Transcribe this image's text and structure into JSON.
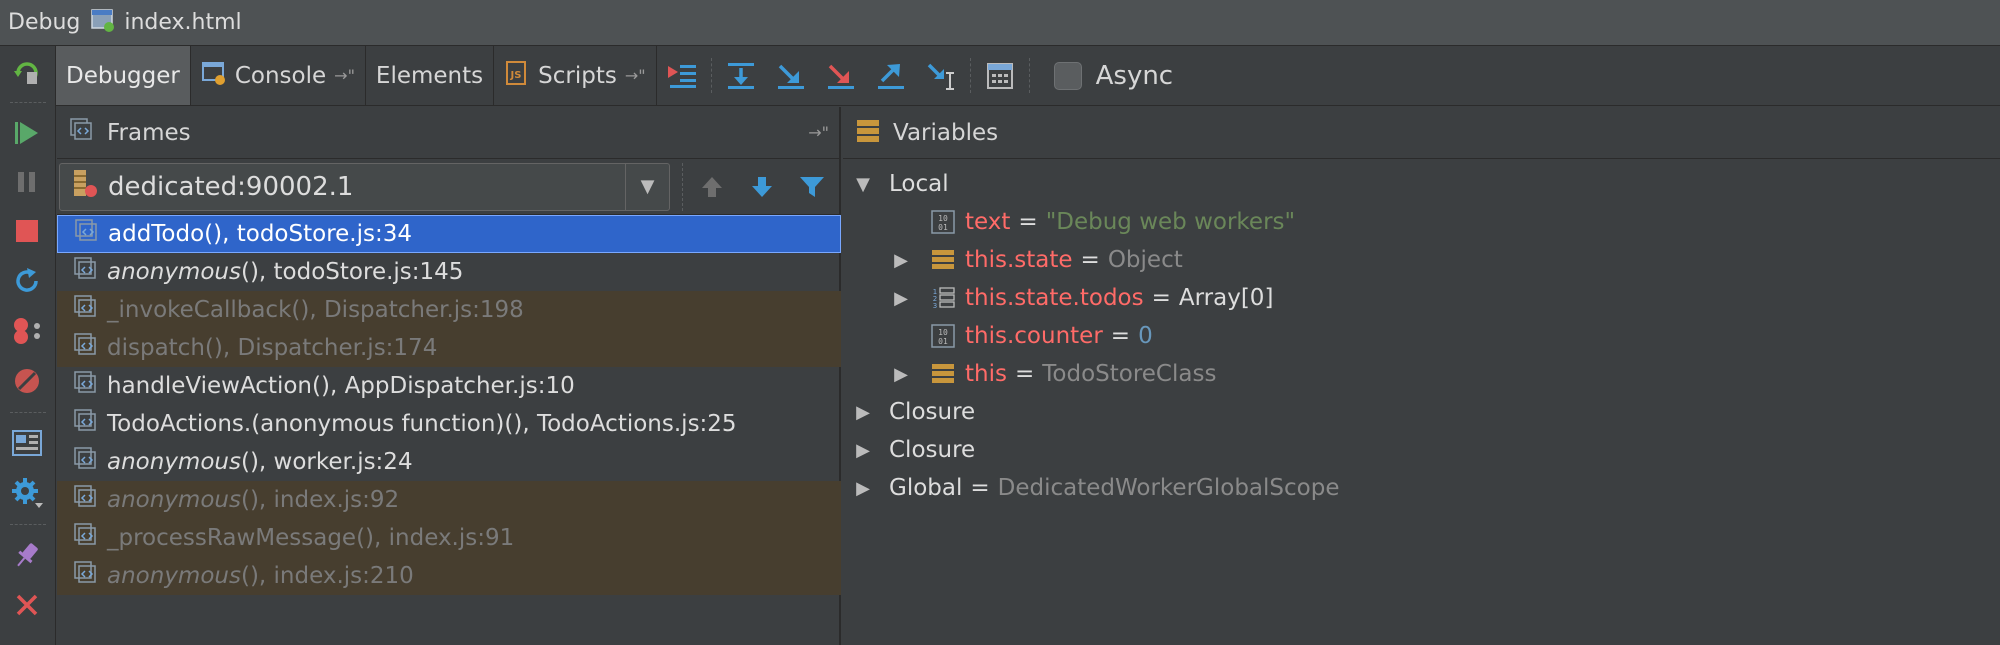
{
  "window": {
    "mode": "Debug",
    "file": "index.html"
  },
  "tabs": {
    "debugger": "Debugger",
    "console": "Console",
    "elements": "Elements",
    "scripts": "Scripts",
    "pin_glyph": "→\""
  },
  "toolbar": {
    "async_label": "Async",
    "async_checked": false
  },
  "frames": {
    "header": "Frames",
    "thread": "dedicated:90002.1",
    "items": [
      {
        "func": "addTodo()",
        "loc": ", todoStore.js:34",
        "kind": "selected"
      },
      {
        "func": "anonymous",
        "suffix": "()",
        "loc": ", todoStore.js:145",
        "kind": "normal",
        "italic": true
      },
      {
        "func": "_invokeCallback()",
        "loc": ", Dispatcher.js:198",
        "kind": "library"
      },
      {
        "func": "dispatch()",
        "loc": ", Dispatcher.js:174",
        "kind": "library"
      },
      {
        "func": "handleViewAction()",
        "loc": ", AppDispatcher.js:10",
        "kind": "normal"
      },
      {
        "func": "TodoActions.(anonymous function)()",
        "loc": ", TodoActions.js:25",
        "kind": "normal"
      },
      {
        "func": "anonymous",
        "suffix": "()",
        "loc": ", worker.js:24",
        "kind": "normal",
        "italic": true
      },
      {
        "func": "anonymous",
        "suffix": "()",
        "loc": ", index.js:92",
        "kind": "library",
        "italic": true
      },
      {
        "func": "_processRawMessage()",
        "loc": ", index.js:91",
        "kind": "library"
      },
      {
        "func": "anonymous",
        "suffix": "()",
        "loc": ", index.js:210",
        "kind": "library",
        "italic": true
      }
    ]
  },
  "variables": {
    "header": "Variables",
    "local_label": "Local",
    "text": {
      "name": "text",
      "value": "\"Debug web workers\""
    },
    "state": {
      "name": "this.state",
      "value": "Object"
    },
    "todos": {
      "name": "this.state.todos",
      "value": "Array[0]"
    },
    "counter": {
      "name": "this.counter",
      "value": "0"
    },
    "this": {
      "name": "this",
      "value": "TodoStoreClass"
    },
    "closure1": "Closure",
    "closure2": "Closure",
    "global": {
      "name": "Global",
      "value": "DedicatedWorkerGlobalScope"
    },
    "equals": "="
  },
  "colors": {
    "selection": "#2f65ca",
    "library_frame_bg": "#473e2f",
    "var_name": "#ff6b68",
    "string_value": "#6a8759",
    "number_value": "#6897bb"
  }
}
